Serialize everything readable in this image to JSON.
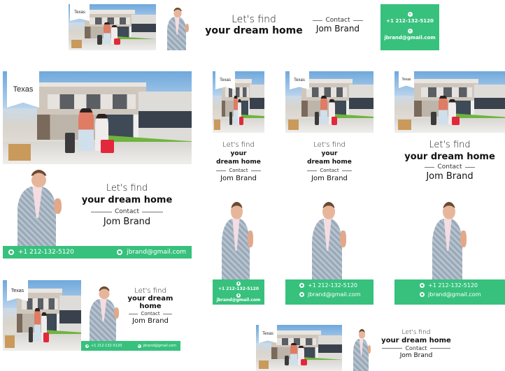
{
  "brand": {
    "accent": "#37c17d",
    "text": "#111111"
  },
  "content": {
    "location_tag": "Texas",
    "headline_line1": "Let's find",
    "headline_line2": "your dream home",
    "headline_line2a": "your dream",
    "headline_line2b": "home",
    "headline_line2c": "your",
    "headline_line2d": "dream home",
    "contact_label": "Contact",
    "agent_name": "Jom Brand",
    "phone": "+1 212-132-5120",
    "email": "jbrand@gmail.com"
  },
  "icons": {
    "phone": "phone-icon",
    "email": "email-icon"
  },
  "banners": [
    "leaderboard-728x90",
    "medium-rectangle-large",
    "skyscraper-160",
    "skyscraper-160b",
    "wide-skyscraper",
    "rectangle-small",
    "half-banner"
  ]
}
